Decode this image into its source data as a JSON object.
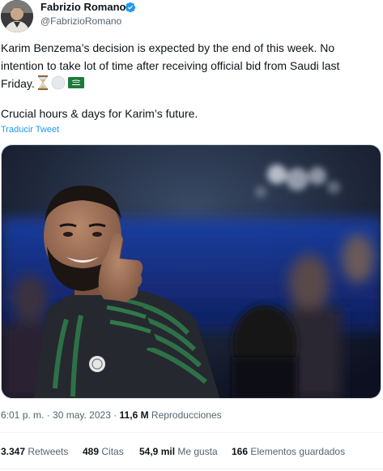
{
  "author": {
    "display_name": "Fabrizio Romano",
    "handle": "@FabrizioRomano",
    "avatar_icon": "profile-photo-icon",
    "verified_icon": "verified-badge-icon",
    "verified_color": "#1d9bf0"
  },
  "tweet": {
    "line1": "Karim Benzema’s decision is expected by the end of this week. No",
    "line2": "intention to take lot of time after receiving official bid from Saudi last",
    "line3": "Friday.",
    "emojis": [
      "hourglass-icon",
      "white-circle-icon",
      "saudi-flag-icon"
    ],
    "para2": "Crucial hours & days for Karim’s future.",
    "translate_link": "Traducir Tweet",
    "media_icon": "benzema-thumbs-up-photo"
  },
  "meta": {
    "time": "6:01 p. m.",
    "sep1": " · ",
    "date": "30 may. 2023",
    "sep2": " · ",
    "views": "11,6 M",
    "views_label": " Reproducciones"
  },
  "stats": {
    "retweets_count": "3.347",
    "retweets_label": " Retweets",
    "quotes_count": "489",
    "quotes_label": " Citas",
    "likes_count": "54,9 mil",
    "likes_label": " Me gusta",
    "bookmarks_count": "166",
    "bookmarks_label": " Elementos guardados"
  },
  "colors": {
    "text": "#0f1419",
    "secondary": "#536471",
    "link": "#1d9bf0"
  }
}
